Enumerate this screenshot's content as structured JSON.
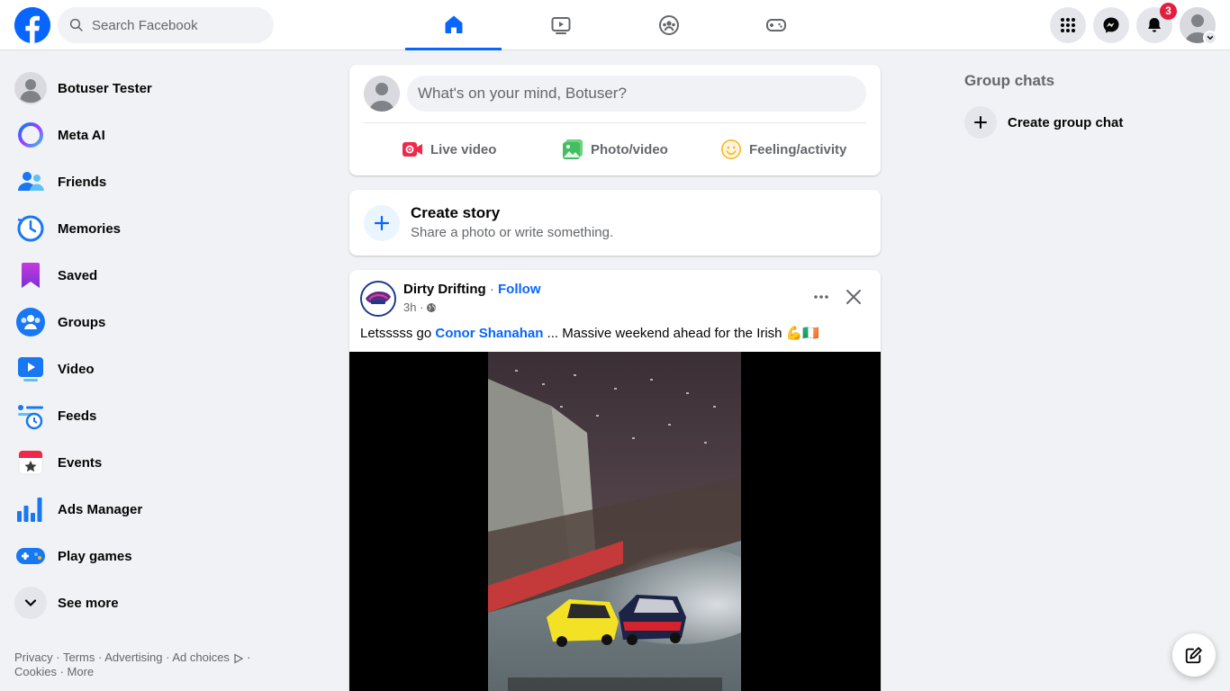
{
  "search": {
    "placeholder": "Search Facebook"
  },
  "header": {
    "nav_tabs": [
      "home-icon",
      "video-icon",
      "groups-icon",
      "gaming-icon"
    ],
    "notification_count": "3",
    "brand_color": "#0866ff"
  },
  "sidebar": {
    "items": [
      {
        "label": "Botuser Tester",
        "icon": "profile-avatar"
      },
      {
        "label": "Meta AI",
        "icon": "meta-ai-icon"
      },
      {
        "label": "Friends",
        "icon": "friends-icon"
      },
      {
        "label": "Memories",
        "icon": "memories-icon"
      },
      {
        "label": "Saved",
        "icon": "saved-icon"
      },
      {
        "label": "Groups",
        "icon": "groups-icon"
      },
      {
        "label": "Video",
        "icon": "video-icon"
      },
      {
        "label": "Feeds",
        "icon": "feeds-icon"
      },
      {
        "label": "Events",
        "icon": "events-icon"
      },
      {
        "label": "Ads Manager",
        "icon": "ads-manager-icon"
      },
      {
        "label": "Play games",
        "icon": "play-games-icon"
      }
    ],
    "see_more": "See more"
  },
  "footer": {
    "privacy": "Privacy",
    "terms": "Terms",
    "advertising": "Advertising",
    "ad_choices": "Ad choices",
    "cookies": "Cookies",
    "more": "More"
  },
  "composer": {
    "placeholder": "What's on your mind, Botuser?",
    "live_video": "Live video",
    "photo_video": "Photo/video",
    "feeling": "Feeling/activity"
  },
  "story": {
    "title": "Create story",
    "subtitle": "Share a photo or write something."
  },
  "post": {
    "page_name": "Dirty Drifting",
    "follow": "Follow",
    "time": "3h",
    "caption_before": "Letsssss go ",
    "mention": "Conor Shanahan",
    "caption_after": " ... Massive weekend ahead for the Irish 💪🇮🇪"
  },
  "right": {
    "group_chats": "Group chats",
    "create_group_chat": "Create group chat"
  }
}
